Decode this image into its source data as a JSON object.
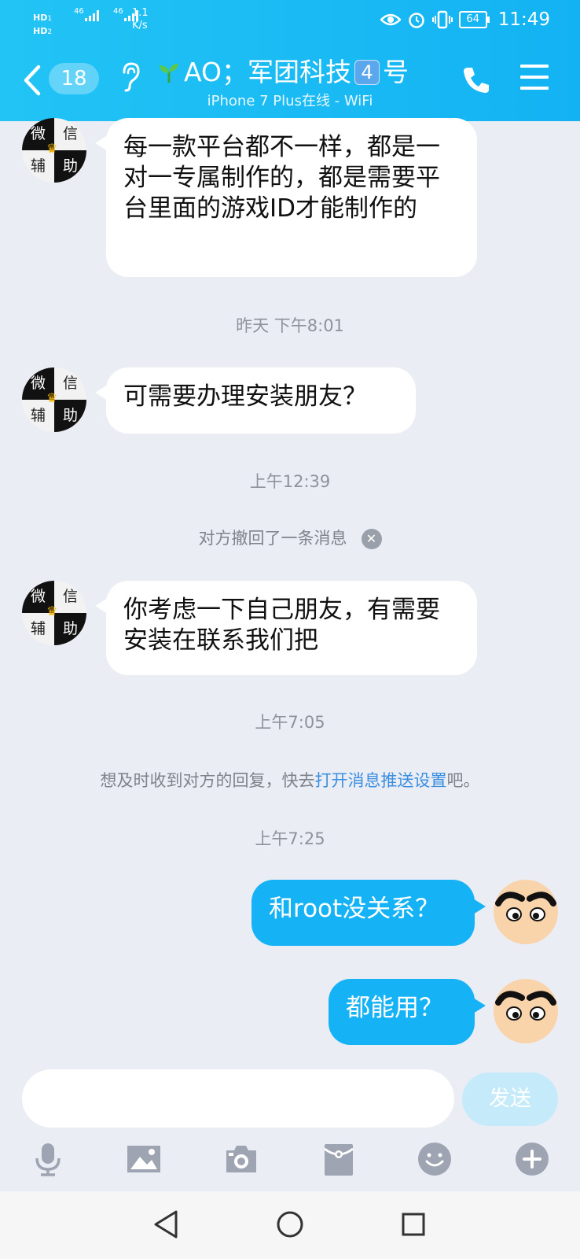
{
  "status_bar": {
    "hd1": "HD",
    "hd2": "HD",
    "net1": "46",
    "net2": "46",
    "speed_value": "1.1",
    "speed_unit": "K/s",
    "battery": "64",
    "time": "11:49"
  },
  "header": {
    "unread_count": "18",
    "contact_name_part1": "AO；军团科技",
    "contact_name_badge": "4",
    "contact_name_part2": "号",
    "contact_status": "iPhone 7 Plus在线 - WiFi"
  },
  "contact_avatar": {
    "tl": "微",
    "tr": "信",
    "bl": "辅",
    "br": "助"
  },
  "messages": [
    {
      "type": "received",
      "text": "每一款平台都不一样，都是一对一专属制作的，都是需要平台里面的游戏ID才能制作的"
    },
    {
      "type": "time",
      "text": "昨天 下午8:01"
    },
    {
      "type": "received",
      "text": "可需要办理安装朋友？"
    },
    {
      "type": "time",
      "text": "上午12:39"
    },
    {
      "type": "system",
      "text": "对方撤回了一条消息"
    },
    {
      "type": "received",
      "text": "你考虑一下自己朋友，有需要安装在联系我们把"
    },
    {
      "type": "time",
      "text": "上午7:05"
    },
    {
      "type": "tip",
      "prefix": "想及时收到对方的回复，快去",
      "link": "打开消息推送设置",
      "suffix": "吧。"
    },
    {
      "type": "time",
      "text": "上午7:25"
    },
    {
      "type": "sent",
      "text": "和root没关系？"
    },
    {
      "type": "sent",
      "text": "都能用？"
    }
  ],
  "input": {
    "placeholder": "",
    "send_label": "发送"
  },
  "toolbar": [
    "microphone-icon",
    "image-icon",
    "camera-icon",
    "red-packet-icon",
    "emoji-icon",
    "plus-icon"
  ],
  "colors": {
    "header": "#1ab8f4",
    "sent_bubble": "#15b2f5",
    "background": "#ebedf5",
    "link": "#3a8fe0"
  }
}
